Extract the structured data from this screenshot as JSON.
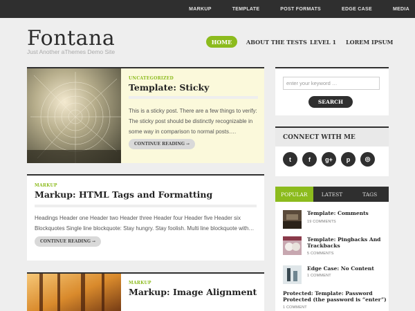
{
  "topnav": {
    "items": [
      "MARKUP",
      "TEMPLATE",
      "POST FORMATS",
      "EDGE CASE",
      "MEDIA"
    ]
  },
  "site": {
    "title": "Fontana",
    "tagline": "Just Another aThemes Demo Site"
  },
  "mainnav": {
    "home": "HOME",
    "items": [
      "ABOUT THE TESTS",
      "LEVEL 1",
      "LOREM IPSUM"
    ]
  },
  "posts": [
    {
      "category": "UNCATEGORIZED",
      "title": "Template: Sticky",
      "excerpt": [
        "This is a sticky post. There are a few things to verify:",
        "The sticky post should be distinctly recognizable in",
        "some way in comparison to normal posts…."
      ],
      "button": "CONTINUE READING →"
    },
    {
      "category": "MARKUP",
      "title": "Markup: HTML Tags and Formatting",
      "excerpt": [
        "Headings Header one Header two Header three Header four Header five Header six",
        "Blockquotes Single line blockquote: Stay hungry. Stay foolish. Multi line blockquote with…"
      ],
      "button": "CONTINUE READING →"
    },
    {
      "category": "MARKUP",
      "title": "Markup: Image Alignment"
    }
  ],
  "search": {
    "placeholder": "enter your keyword …",
    "button": "SEARCH"
  },
  "connect": {
    "title": "CONNECT WITH ME",
    "icons": [
      "twitter-icon",
      "facebook-icon",
      "google-plus-icon",
      "pinterest-icon",
      "instagram-icon"
    ],
    "glyphs": [
      "t",
      "f",
      "g+",
      "p",
      "◎"
    ]
  },
  "tabs": {
    "labels": [
      "POPULAR",
      "LATEST",
      "TAGS"
    ],
    "items": [
      {
        "title": "Template: Comments",
        "meta": "19 COMMENTS"
      },
      {
        "title": "Template: Pingbacks And Trackbacks",
        "meta": "5 COMMENTS"
      },
      {
        "title": "Edge Case: No Content",
        "meta": "1 COMMENT"
      },
      {
        "title": "Protected: Template: Password Protected (the password is “enter”)",
        "meta": "1 COMMENT"
      }
    ]
  },
  "colors": {
    "accent": "#8cbb1d",
    "dark": "#2f2f2f",
    "sticky_bg": "#fbf9db"
  }
}
